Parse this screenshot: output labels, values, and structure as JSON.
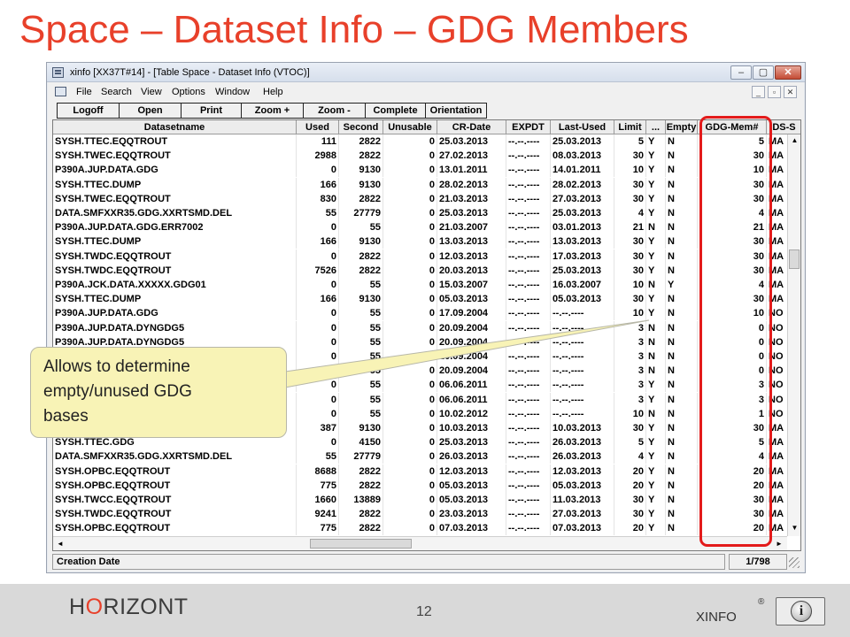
{
  "slide": {
    "title": "Space – Dataset Info – GDG Members",
    "callout_lines": [
      "Allows to determine",
      "empty/unused GDG",
      "bases"
    ],
    "highlight_color": "#e31b1b",
    "title_color": "#e8402a"
  },
  "window": {
    "title": "xinfo [XX37T#14] - [Table Space - Dataset Info (VTOC)]",
    "controls": {
      "minimize": "–",
      "maximize": "▢",
      "close": "✕"
    },
    "mdi_controls": {
      "minimize": "_",
      "restore": "▫",
      "close": "✕"
    }
  },
  "menu": [
    {
      "label": "File"
    },
    {
      "label": "Search"
    },
    {
      "label": "View"
    },
    {
      "label": "Options"
    },
    {
      "label": "Window"
    },
    {
      "label": "Help"
    }
  ],
  "toolbar": [
    "Logoff",
    "Open",
    "Print",
    "Zoom +",
    "Zoom -",
    "Complete",
    "Orientation"
  ],
  "table": {
    "columns": [
      "Datasetname",
      "Used",
      "Second",
      "Unusable",
      "CR-Date",
      "EXPDT",
      "Last-Used",
      "Limit",
      "...",
      "Empty",
      "GDG-Mem#",
      "DS-S"
    ],
    "rows": [
      [
        "SYSH.TTEC.EQQTROUT",
        "111",
        "2822",
        "0",
        "25.03.2013",
        "--.--.----",
        "25.03.2013",
        "5",
        "Y",
        "N",
        "5",
        "MA"
      ],
      [
        "SYSH.TWEC.EQQTROUT",
        "2988",
        "2822",
        "0",
        "27.02.2013",
        "--.--.----",
        "08.03.2013",
        "30",
        "Y",
        "N",
        "30",
        "MA"
      ],
      [
        "P390A.JUP.DATA.GDG",
        "0",
        "9130",
        "0",
        "13.01.2011",
        "--.--.----",
        "14.01.2011",
        "10",
        "Y",
        "N",
        "10",
        "MA"
      ],
      [
        "SYSH.TTEC.DUMP",
        "166",
        "9130",
        "0",
        "28.02.2013",
        "--.--.----",
        "28.02.2013",
        "30",
        "Y",
        "N",
        "30",
        "MA"
      ],
      [
        "SYSH.TWEC.EQQTROUT",
        "830",
        "2822",
        "0",
        "21.03.2013",
        "--.--.----",
        "27.03.2013",
        "30",
        "Y",
        "N",
        "30",
        "MA"
      ],
      [
        "DATA.SMFXXR35.GDG.XXRTSMD.DEL",
        "55",
        "27779",
        "0",
        "25.03.2013",
        "--.--.----",
        "25.03.2013",
        "4",
        "Y",
        "N",
        "4",
        "MA"
      ],
      [
        "P390A.JUP.DATA.GDG.ERR7002",
        "0",
        "55",
        "0",
        "21.03.2007",
        "--.--.----",
        "03.01.2013",
        "21",
        "N",
        "N",
        "21",
        "MA"
      ],
      [
        "SYSH.TTEC.DUMP",
        "166",
        "9130",
        "0",
        "13.03.2013",
        "--.--.----",
        "13.03.2013",
        "30",
        "Y",
        "N",
        "30",
        "MA"
      ],
      [
        "SYSH.TWDC.EQQTROUT",
        "0",
        "2822",
        "0",
        "12.03.2013",
        "--.--.----",
        "17.03.2013",
        "30",
        "Y",
        "N",
        "30",
        "MA"
      ],
      [
        "SYSH.TWDC.EQQTROUT",
        "7526",
        "2822",
        "0",
        "20.03.2013",
        "--.--.----",
        "25.03.2013",
        "30",
        "Y",
        "N",
        "30",
        "MA"
      ],
      [
        "P390A.JCK.DATA.XXXXX.GDG01",
        "0",
        "55",
        "0",
        "15.03.2007",
        "--.--.----",
        "16.03.2007",
        "10",
        "N",
        "Y",
        "4",
        "MA"
      ],
      [
        "SYSH.TTEC.DUMP",
        "166",
        "9130",
        "0",
        "05.03.2013",
        "--.--.----",
        "05.03.2013",
        "30",
        "Y",
        "N",
        "30",
        "MA"
      ],
      [
        "P390A.JUP.DATA.GDG",
        "0",
        "55",
        "0",
        "17.09.2004",
        "--.--.----",
        "--.--.----",
        "10",
        "Y",
        "N",
        "10",
        "NO"
      ],
      [
        "P390A.JUP.DATA.DYNGDG5",
        "0",
        "55",
        "0",
        "20.09.2004",
        "--.--.----",
        "--.--.----",
        "3",
        "N",
        "N",
        "0",
        "NO"
      ],
      [
        "P390A.JUP.DATA.DYNGDG5",
        "0",
        "55",
        "0",
        "20.09.2004",
        "--.--.----",
        "--.--.----",
        "3",
        "N",
        "N",
        "0",
        "NO"
      ],
      [
        "",
        "0",
        "55",
        "0",
        "20.09.2004",
        "--.--.----",
        "--.--.----",
        "3",
        "N",
        "N",
        "0",
        "NO"
      ],
      [
        "",
        "0",
        "55",
        "0",
        "20.09.2004",
        "--.--.----",
        "--.--.----",
        "3",
        "N",
        "N",
        "0",
        "NO"
      ],
      [
        "",
        "0",
        "55",
        "0",
        "06.06.2011",
        "--.--.----",
        "--.--.----",
        "3",
        "Y",
        "N",
        "3",
        "NO"
      ],
      [
        "",
        "0",
        "55",
        "0",
        "06.06.2011",
        "--.--.----",
        "--.--.----",
        "3",
        "Y",
        "N",
        "3",
        "NO"
      ],
      [
        "",
        "0",
        "55",
        "0",
        "10.02.2012",
        "--.--.----",
        "--.--.----",
        "10",
        "N",
        "N",
        "1",
        "NO"
      ],
      [
        "",
        "387",
        "9130",
        "0",
        "10.03.2013",
        "--.--.----",
        "10.03.2013",
        "30",
        "Y",
        "N",
        "30",
        "MA"
      ],
      [
        "SYSH.TTEC.GDG",
        "0",
        "4150",
        "0",
        "25.03.2013",
        "--.--.----",
        "26.03.2013",
        "5",
        "Y",
        "N",
        "5",
        "MA"
      ],
      [
        "DATA.SMFXXR35.GDG.XXRTSMD.DEL",
        "55",
        "27779",
        "0",
        "26.03.2013",
        "--.--.----",
        "26.03.2013",
        "4",
        "Y",
        "N",
        "4",
        "MA"
      ],
      [
        "SYSH.OPBC.EQQTROUT",
        "8688",
        "2822",
        "0",
        "12.03.2013",
        "--.--.----",
        "12.03.2013",
        "20",
        "Y",
        "N",
        "20",
        "MA"
      ],
      [
        "SYSH.OPBC.EQQTROUT",
        "775",
        "2822",
        "0",
        "05.03.2013",
        "--.--.----",
        "05.03.2013",
        "20",
        "Y",
        "N",
        "20",
        "MA"
      ],
      [
        "SYSH.TWCC.EQQTROUT",
        "1660",
        "13889",
        "0",
        "05.03.2013",
        "--.--.----",
        "11.03.2013",
        "30",
        "Y",
        "N",
        "30",
        "MA"
      ],
      [
        "SYSH.TWDC.EQQTROUT",
        "9241",
        "2822",
        "0",
        "23.03.2013",
        "--.--.----",
        "27.03.2013",
        "30",
        "Y",
        "N",
        "30",
        "MA"
      ],
      [
        "SYSH.OPBC.EQQTROUT",
        "775",
        "2822",
        "0",
        "07.03.2013",
        "--.--.----",
        "07.03.2013",
        "20",
        "Y",
        "N",
        "20",
        "MA"
      ]
    ]
  },
  "scrollbar": {
    "up": "▲",
    "down": "▼",
    "left": "◄",
    "right": "►"
  },
  "status": {
    "label": "Creation Date",
    "position": "1/798"
  },
  "footer": {
    "brand_pre": "H",
    "brand_o": "O",
    "brand_post": "RIZONT",
    "page_number": "12",
    "product": "XINFO",
    "registered": "®",
    "info_icon": "info-icon",
    "info_glyph": "i"
  }
}
